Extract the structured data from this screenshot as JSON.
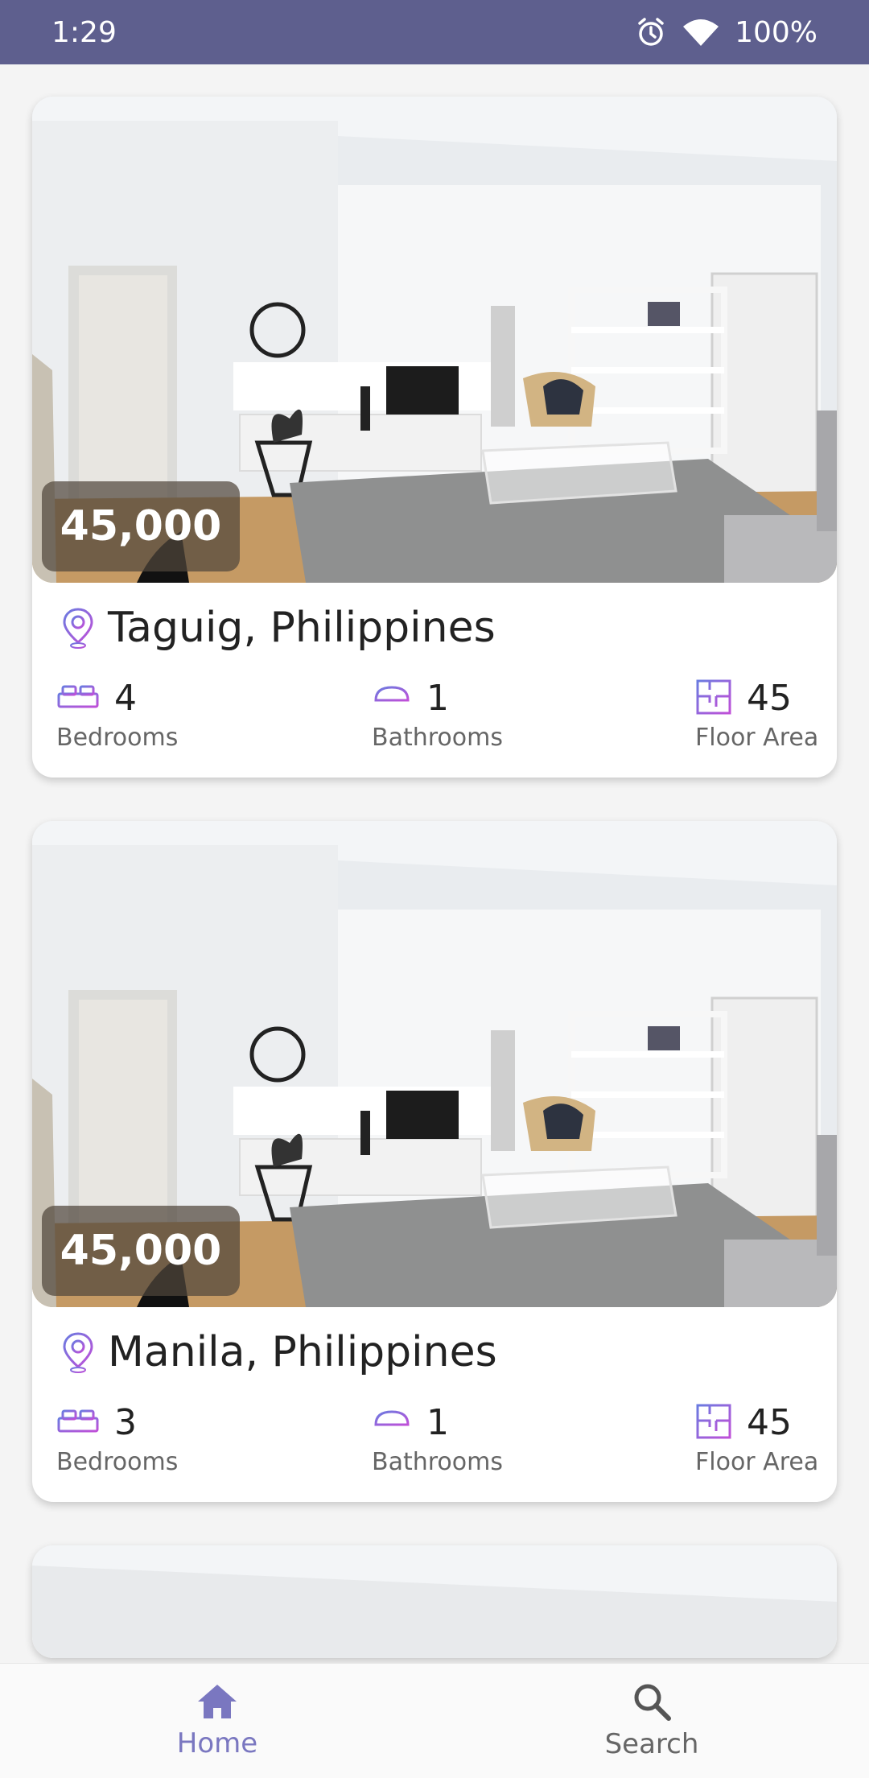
{
  "status_bar": {
    "time": "1:29",
    "battery": "100%",
    "icons": [
      "alarm-icon",
      "wifi-icon"
    ]
  },
  "listings": [
    {
      "price": "45,000",
      "location": "Taguig, Philippines",
      "bedrooms": "4",
      "bedrooms_label": "Bedrooms",
      "bathrooms": "1",
      "bathrooms_label": "Bathrooms",
      "floor_area": "45",
      "floor_area_label": "Floor Area"
    },
    {
      "price": "45,000",
      "location": "Manila, Philippines",
      "bedrooms": "3",
      "bedrooms_label": "Bedrooms",
      "bathrooms": "1",
      "bathrooms_label": "Bathrooms",
      "floor_area": "45",
      "floor_area_label": "Floor Area"
    }
  ],
  "bottom_nav": {
    "home_label": "Home",
    "search_label": "Search"
  },
  "colors": {
    "status_bar": "#5e5f8e",
    "accent": "#7a77c0",
    "icon_gradient_start": "#6a7be0",
    "icon_gradient_end": "#c04fd8"
  }
}
